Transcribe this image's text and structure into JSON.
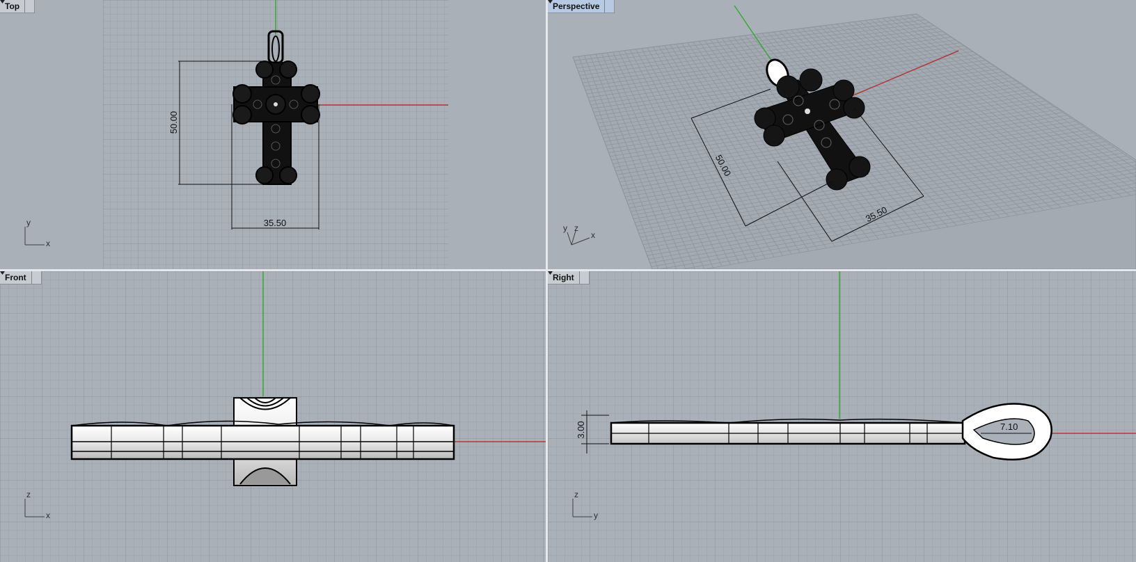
{
  "viewports": {
    "top": {
      "title": "Top",
      "dimensions": {
        "height": "50.00",
        "width": "35.50"
      },
      "axes": {
        "vertical": "y",
        "horizontal": "x"
      }
    },
    "perspective": {
      "title": "Perspective",
      "dimensions": {
        "height": "50.00",
        "width": "35.50"
      },
      "axes": {
        "a": "y",
        "b": "z",
        "c": "x"
      }
    },
    "front": {
      "title": "Front",
      "axes": {
        "vertical": "z",
        "horizontal": "x"
      }
    },
    "right": {
      "title": "Right",
      "dimensions": {
        "thickness": "3.00",
        "bail": "7.10"
      },
      "axes": {
        "vertical": "z",
        "horizontal": "y"
      }
    }
  },
  "colors": {
    "viewport_bg": "#a9b0b7",
    "grid_minor": "#9aa1a8",
    "grid_major": "#8b9299",
    "x_axis": "#b03a3a",
    "y_axis": "#3aa53a",
    "active_tab": "#b6cbe3"
  }
}
